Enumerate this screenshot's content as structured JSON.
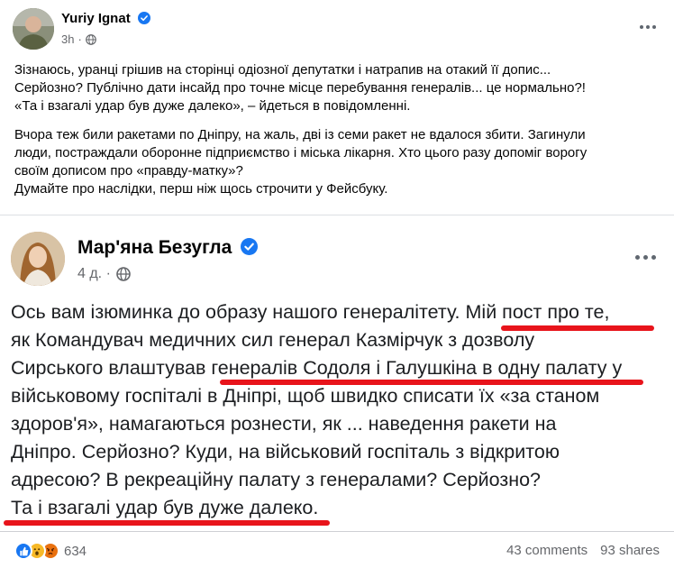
{
  "post": {
    "author": "Yuriy Ignat",
    "time": "3h",
    "paragraph1": [
      "Зізнаюсь, уранці грішив на сторінці одіозної депутатки і натрапив на отакий її допис...",
      "Серйозно? Публічно дати інсайд про точне місце перебування генералів... це нормально?!",
      "«Та і взагалі удар був дуже далеко», – йдеться в повідомленні."
    ],
    "paragraph2": [
      "Вчора теж били ракетами по Дніпру, на жаль, дві із семи ракет не вдалося збити. Загинули",
      "люди, постраждали оборонне підприємство і міська лікарня. Хто цього разу допоміг ворогу",
      "своїм дописом про «правду-матку»?",
      "Думайте про наслідки, перш ніж щось строчити у Фейсбуку."
    ]
  },
  "shared": {
    "author": "Мар'яна Безугла",
    "time": "4 д. ·",
    "lines": [
      "Ось вам ізюминка до образу нашого генералітету. Мій пост про те,",
      "як Командувач медичних сил генерал Казмірчук з дозволу",
      "Сирського влаштував генералів Содоля і Галушкіна в одну палату у",
      "військовому госпіталі в Дніпрі, щоб швидко списати їх «за станом",
      "здоров'я», намагаються рознести, як ... наведення ракети на",
      "Дніпро. Серйозно? Куди, на військовий госпіталь з відкритою",
      "адресою? В рекреаційну палату з генералами? Серйозно?",
      "Та і взагалі удар був дуже далеко."
    ],
    "highlight_color": "#e8141b"
  },
  "footer": {
    "reaction_count": "634",
    "comments": "43 comments",
    "shares": "93 shares"
  },
  "colors": {
    "verified": "#1877f2",
    "secondary_text": "#65676b",
    "like": "#1877f2",
    "wow": "#f7b928",
    "angry": "#e9710f"
  },
  "icons": [
    "verified-badge-icon",
    "globe-icon",
    "more-options-icon",
    "like-reaction-icon",
    "wow-reaction-icon",
    "angry-reaction-icon"
  ]
}
